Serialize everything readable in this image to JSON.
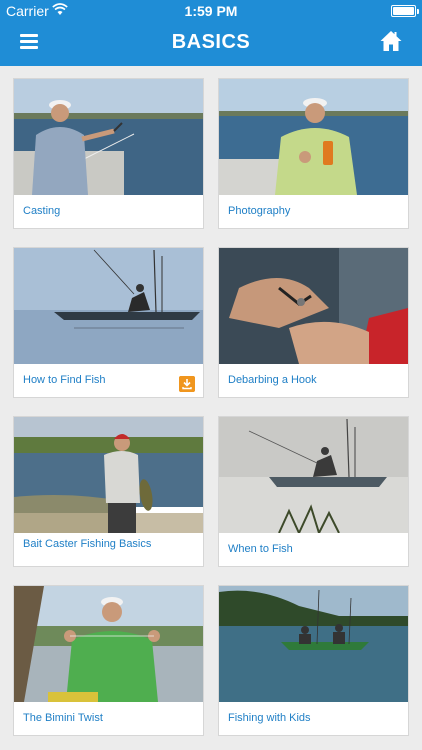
{
  "status_bar": {
    "carrier": "Carrier",
    "time": "1:59 PM"
  },
  "nav": {
    "title": "BASICS"
  },
  "icons": {
    "menu": "hamburger-menu-icon",
    "home": "home-icon",
    "download": "download-icon",
    "wifi": "wifi-icon",
    "battery": "battery-icon"
  },
  "colors": {
    "accent": "#1f8dd6",
    "label": "#1f7fc6",
    "badge": "#f0961e"
  },
  "cards": [
    {
      "label": "Casting"
    },
    {
      "label": "Photography"
    },
    {
      "label": "How to Find Fish",
      "downloaded": true
    },
    {
      "label": "Debarbing a Hook"
    },
    {
      "label": "Bait Caster Fishing Basics"
    },
    {
      "label": "When to Fish"
    },
    {
      "label": "The Bimini Twist"
    },
    {
      "label": "Fishing with Kids"
    }
  ]
}
